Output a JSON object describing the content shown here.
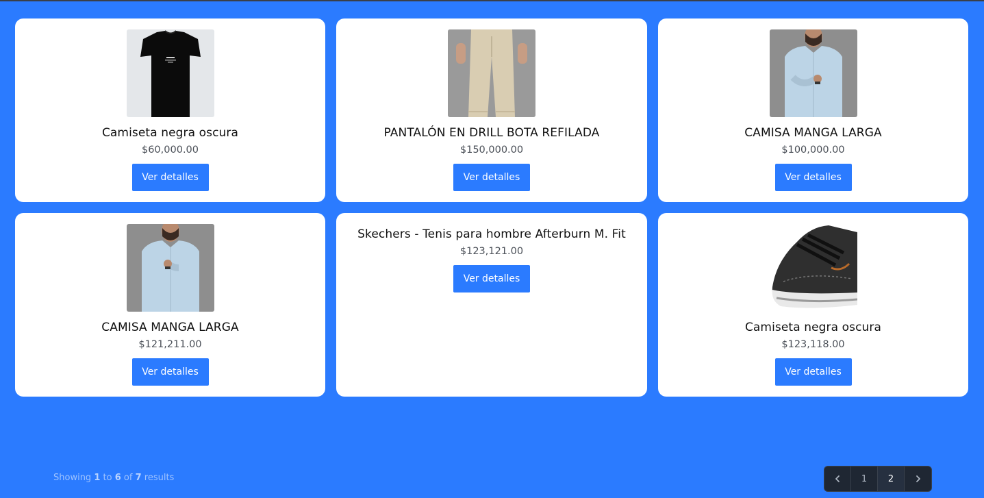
{
  "products": [
    {
      "title": "Camiseta negra oscura",
      "price": "$60,000.00",
      "image": "black-tshirt",
      "button": "Ver detalles"
    },
    {
      "title": "PANTALÓN EN DRILL BOTA REFILADA",
      "price": "$150,000.00",
      "image": "beige-pants",
      "button": "Ver detalles"
    },
    {
      "title": "CAMISA MANGA LARGA",
      "price": "$100,000.00",
      "image": "lightblue-shirt",
      "button": "Ver detalles"
    },
    {
      "title": "CAMISA MANGA LARGA",
      "price": "$121,211.00",
      "image": "lightblue-shirt",
      "button": "Ver detalles"
    },
    {
      "title": "Skechers - Tenis para hombre Afterburn M. Fit",
      "price": "$123,121.00",
      "image": null,
      "button": "Ver detalles"
    },
    {
      "title": "Camiseta negra oscura",
      "price": "$123,118.00",
      "image": "black-sneaker",
      "button": "Ver detalles"
    }
  ],
  "pagination": {
    "showing_label": "Showing",
    "from": "1",
    "to_label": "to",
    "to": "6",
    "of_label": "of",
    "total": "7",
    "results_label": "results",
    "pages": [
      "1",
      "2"
    ],
    "active_page": "2",
    "prev_icon": "chevron-left-icon",
    "next_icon": "chevron-right-icon"
  },
  "colors": {
    "background": "#2b7bff",
    "button": "#2b7bff",
    "card": "#ffffff",
    "pager": "#1f2733"
  }
}
